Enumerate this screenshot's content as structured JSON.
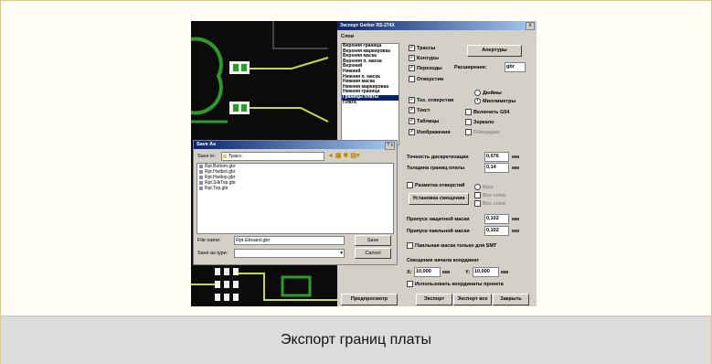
{
  "caption": "Экспорт границ платы",
  "export_dialog": {
    "title": "Экспорт Gerber RS-274X",
    "close_label": "x",
    "layers_label": "Слои",
    "layers": [
      "Верхняя граница",
      "Верхняя маркировка",
      "Верхняя маска",
      "Верхняя п. маска",
      "Верхний",
      "Нижний",
      "Нижняя п. маска",
      "Нижняя маска",
      "Нижняя маркировка",
      "Нижняя граница",
      "Границы платы",
      "Плата"
    ],
    "selected_layer_index": 10,
    "checks_col1": [
      {
        "label": "Трассы",
        "checked": true
      },
      {
        "label": "Контуры",
        "checked": true
      },
      {
        "label": "Переходы",
        "checked": true
      },
      {
        "label": "Отверстия",
        "checked": false
      },
      {
        "label": "Тех. отверстия",
        "checked": true
      },
      {
        "label": "Текст",
        "checked": true
      },
      {
        "label": "Таблицы",
        "checked": true
      },
      {
        "label": "Изображения",
        "checked": true
      }
    ],
    "apertures_button": "Апертуры",
    "extension_label": "Расширение:",
    "extension_value": "gbr",
    "units": [
      "Дюймы",
      "Миллиметры"
    ],
    "units_selected": 1,
    "checks_col2": [
      {
        "label": "Включить G54",
        "checked": false
      },
      {
        "label": "Зеркало",
        "checked": false
      },
      {
        "label": "Площадки",
        "checked": false
      }
    ],
    "precision_label": "Точность дискретизации",
    "precision_value": "0,076",
    "precision_unit": "мм",
    "border_width_label": "Толщина границ платы",
    "border_width_value": "0,14",
    "border_width_unit": "мм",
    "mark_holes_label": "Разметка отверстий",
    "mark_holes_checked": false,
    "install_offset_button": "Установка смещения",
    "mark_options": [
      "Круг",
      "Все слои",
      "Все слои"
    ],
    "mask_margin_label": "Припуск защитной маски",
    "mask_margin_value": "0,102",
    "mask_margin_unit": "мм",
    "paste_margin_label": "Припуск паяльной маски",
    "paste_margin_value": "0,102",
    "paste_margin_unit": "мм",
    "smt_label": "Паяльная маска только для SMT",
    "smt_checked": false,
    "offset_label": "Смещение начала координат",
    "x_label": "X:",
    "x_value": "10,000",
    "x_unit": "мм",
    "y_label": "Y:",
    "y_value": "10,000",
    "y_unit": "мм",
    "use_project_label": "Использовать координаты проекта",
    "use_project_checked": false,
    "preview_button": "Предпросмотр",
    "export_button": "Экспорт",
    "export_all_button": "Экспорт все",
    "close_button": "Закрыть"
  },
  "save_dialog": {
    "title": "Save As",
    "help": "? x",
    "save_in_label": "Save in:",
    "save_in_value": "Трасс",
    "files": [
      "Rpt.Bottom.gbr",
      "Rpt.Hwtbot.gbr",
      "Rpt.Hwttop.gbr",
      "Rpt.SilkTop.gbr",
      "Rpt.Top.gbr"
    ],
    "file_name_label": "File name:",
    "file_name_value": "Rpt.Eboard.gbr",
    "save_type_label": "Save as type:",
    "save_type_value": "",
    "save_button": "Save",
    "cancel_button": "Cancel"
  }
}
